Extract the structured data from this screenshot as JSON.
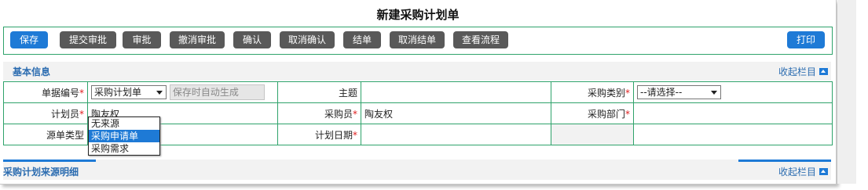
{
  "page_title": "新建采购计划单",
  "toolbar": {
    "save": "保存",
    "submit_approval": "提交审批",
    "approve": "审批",
    "cancel_approval": "撤消审批",
    "confirm": "确认",
    "cancel_confirm": "取消确认",
    "close_order": "结单",
    "cancel_close": "取消结单",
    "view_flow": "查看流程",
    "print": "打印"
  },
  "basic_info": {
    "title": "基本信息",
    "collapse": "收起栏目"
  },
  "form": {
    "doc_no_label": "单据编号",
    "doc_no_select": "采购计划单",
    "doc_no_placeholder": "保存时自动生成",
    "subject_label": "主题",
    "subject_value": "",
    "purchase_type_label": "采购类别",
    "purchase_type_value": "--请选择--",
    "planner_label": "计划员",
    "planner_value": "陶友权",
    "purchaser_label": "采购员",
    "purchaser_value": "陶友权",
    "purchase_dept_label": "采购部门",
    "purchase_dept_value": "",
    "source_type_label": "源单类型",
    "plan_date_label": "计划日期",
    "plan_date_value": ""
  },
  "source_type_dropdown": {
    "options": [
      "无来源",
      "采购申请单",
      "采购需求"
    ],
    "highlighted_index": 1
  },
  "detail_section": {
    "title": "采购计划来源明细",
    "collapse": "收起栏目"
  },
  "colors": {
    "accent": "#1e7ad6",
    "border": "#2fa36b",
    "dark_button": "#595959",
    "required": "#e02020"
  }
}
